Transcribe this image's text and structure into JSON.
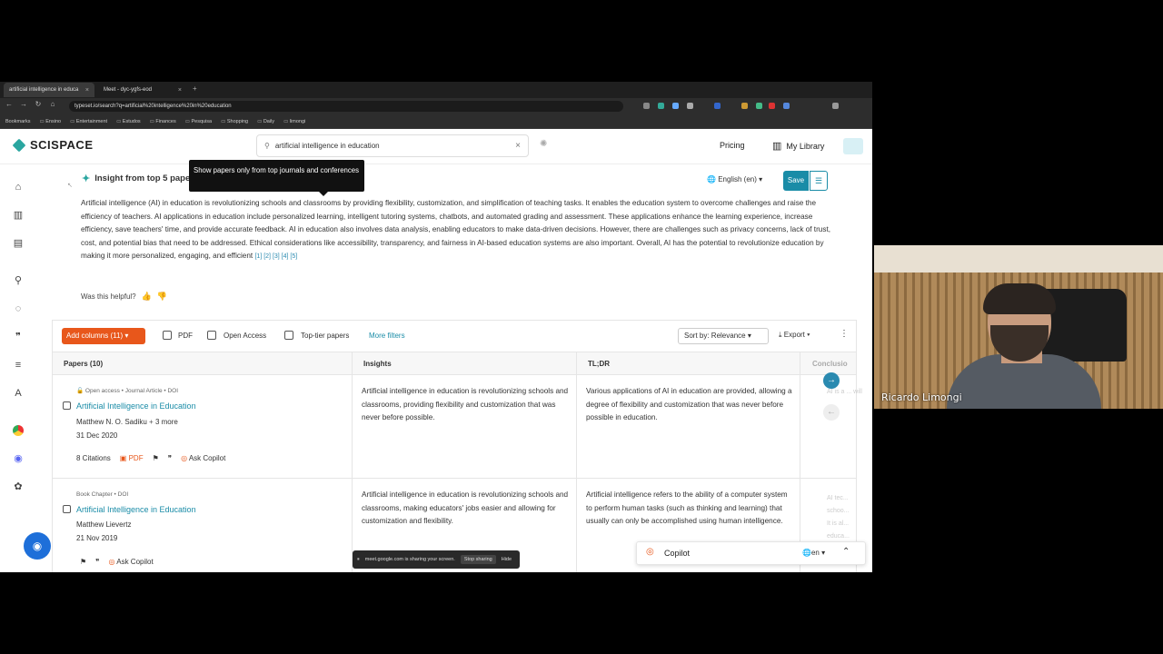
{
  "browser": {
    "tabs": [
      {
        "label": "artificial intelligence in educa"
      },
      {
        "label": "Meet - dyc-ygfs-eod"
      }
    ],
    "url": "typeset.io/search?q=artificial%20intelligence%20in%20education",
    "bookmarks": [
      "Bookmarks",
      "Ensino",
      "Entertainment",
      "Estudos",
      "Finances",
      "Pesquisa",
      "Shopping",
      "Daily",
      "limongi"
    ]
  },
  "app": {
    "logo": "SCISPACE",
    "search_value": "artificial intelligence in education",
    "pricing": "Pricing",
    "my_library": "My Library",
    "insight": {
      "title": "Insight from top 5 papers",
      "language": "English (en)",
      "save": "Save",
      "body": "Artificial intelligence (AI) in education is revolutionizing schools and classrooms by providing flexibility, customization, and simplification of teaching tasks. It enables the education system to overcome challenges and raise the efficiency of teachers. AI applications in education include personalized learning, intelligent tutoring systems, chatbots, and automated grading and assessment. These applications enhance the learning experience, increase efficiency, save teachers' time, and provide accurate feedback. AI in education also involves data analysis, enabling educators to make data-driven decisions. However, there are challenges such as privacy concerns, lack of trust, cost, and potential bias that need to be addressed. Ethical considerations like accessibility, transparency, and fairness in AI-based education systems are also important. Overall, AI has the potential to revolutionize education by making it more personalized, engaging, and efficient",
      "refs": "[1] [2] [3] [4] [5]",
      "helpful": "Was this helpful?"
    },
    "tooltip": "Show papers only from top journals and conferences",
    "filters": {
      "add_columns": "Add columns (11)",
      "pdf": "PDF",
      "open_access": "Open Access",
      "top_tier": "Top-tier papers",
      "more": "More filters",
      "sort": "Sort by: Relevance",
      "export": "Export"
    },
    "table": {
      "headers": [
        "Papers (10)",
        "Insights",
        "TL;DR",
        "Conclusio"
      ],
      "rows": [
        {
          "meta_oa": "Open access",
          "meta": "• Journal Article • DOI",
          "title": "Artificial Intelligence in Education",
          "authors": "Matthew N. O. Sadiku",
          "more": "3 more",
          "date": "31 Dec 2020",
          "citations": "8 Citations",
          "pdf": "PDF",
          "ask": "Ask Copilot",
          "insight": "Artificial intelligence in education is revolutionizing schools and classrooms, providing flexibility and customization that was never before possible.",
          "tldr": "Various applications of AI in education are provided, allowing a degree of flexibility and customization that was never before possible in education.",
          "conclusion": "AI is a ... will"
        },
        {
          "meta": "Book Chapter • DOI",
          "title": "Artificial Intelligence in Education",
          "authors": "Matthew Lievertz",
          "date": "21 Nov 2019",
          "ask": "Ask Copilot",
          "insight": "Artificial intelligence in education is revolutionizing schools and classrooms, making educators' jobs easier and allowing for customization and flexibility.",
          "tldr": "Artificial intelligence refers to the ability of a computer system to perform human tasks (such as thinking and learning) that usually can only be accomplished using human intelligence.",
          "conclusion": "AI tec... schoo... It is al... educa..."
        }
      ]
    },
    "copilot": {
      "label": "Copilot",
      "lang": "en"
    }
  },
  "screen_share": {
    "text": "meet.google.com is sharing your screen.",
    "stop": "Stop sharing",
    "hide": "Hide"
  },
  "webcam": {
    "name": "Ricardo Limongi"
  }
}
